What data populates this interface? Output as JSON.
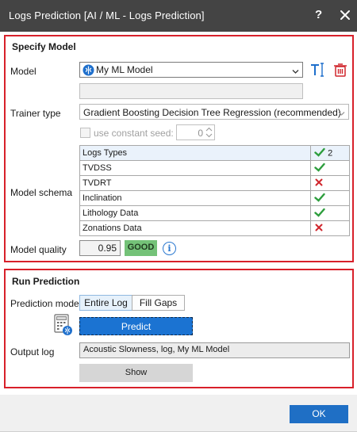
{
  "window": {
    "title": "Logs Prediction [AI / ML - Logs Prediction]",
    "help_label": "?",
    "close_icon": "close-icon"
  },
  "specify_model": {
    "section_title": "Specify Model",
    "model_label": "Model",
    "model_value": "My ML Model",
    "trainer_label": "Trainer type",
    "trainer_value": "Gradient Boosting Decision Tree Regression (recommended)",
    "seed_label": "use constant seed:",
    "seed_checked": false,
    "seed_value": "0",
    "schema_label": "Model schema",
    "schema_header": {
      "name": "Logs Types",
      "count": "2"
    },
    "schema_rows": [
      {
        "name": "TVDSS",
        "status": "check"
      },
      {
        "name": "TVDRT",
        "status": "cross"
      },
      {
        "name": "Inclination",
        "status": "check"
      },
      {
        "name": "Lithology Data",
        "status": "check"
      },
      {
        "name": "Zonations Data",
        "status": "cross"
      }
    ],
    "quality_label": "Model quality",
    "quality_value": "0.95",
    "quality_badge": "GOOD",
    "info_glyph": "i"
  },
  "run_prediction": {
    "section_title": "Run Prediction",
    "mode_label": "Prediction mode",
    "modes": [
      "Entire Log",
      "Fill Gaps"
    ],
    "active_mode": "Entire Log",
    "predict_label": "Predict",
    "output_label": "Output log",
    "output_value": "Acoustic Slowness, log, My ML Model",
    "show_label": "Show"
  },
  "footer": {
    "ok_label": "OK"
  },
  "colors": {
    "titlebar": "#444444",
    "section_border": "#d8202a",
    "accent_blue": "#1b73d2",
    "good_green": "#74c278",
    "check_green": "#2e9e3e",
    "cross_red": "#d0262d"
  }
}
